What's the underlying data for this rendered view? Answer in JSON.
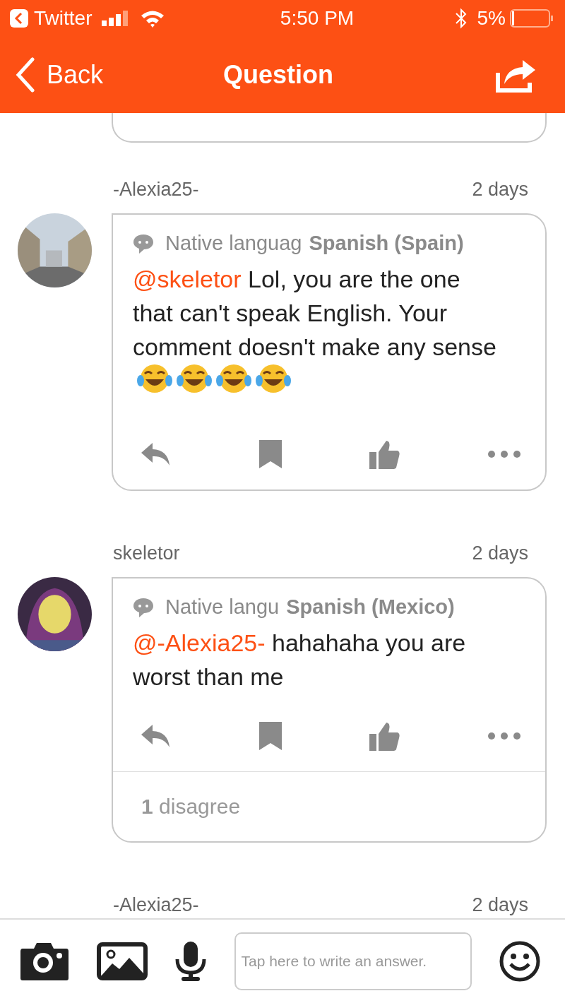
{
  "status_bar": {
    "back_app": "Twitter",
    "time": "5:50 PM",
    "battery": "5%"
  },
  "nav": {
    "back": "Back",
    "title": "Question"
  },
  "answers": [
    {
      "user": "-Alexia25-",
      "age": "2 days",
      "native_label": "Native languag",
      "native_value": "Spanish (Spain)",
      "mention": "@skeletor",
      "text": "Lol, you are the one that can't speak English. Your comment doesn't make any sense",
      "emoji": [
        {
          "kind": "tears-of-joy"
        },
        {
          "kind": "tears-of-joy"
        },
        {
          "kind": "tears-of-joy"
        },
        {
          "kind": "tears-of-joy"
        }
      ]
    },
    {
      "user": "skeletor",
      "age": "2 days",
      "avatar": {
        "kind": "silhouette"
      },
      "native_label": "Native langu",
      "native_value": "Spanish (Mexico)",
      "mention": "@-Alexia25-",
      "text": " hahahaha you are worst than me",
      "disagree": {
        "count": "1",
        "label": "disagree"
      }
    },
    {
      "user": "-Alexia25-",
      "age": "2 days"
    }
  ],
  "composer": {
    "placeholder": "Tap here to write an answer."
  }
}
